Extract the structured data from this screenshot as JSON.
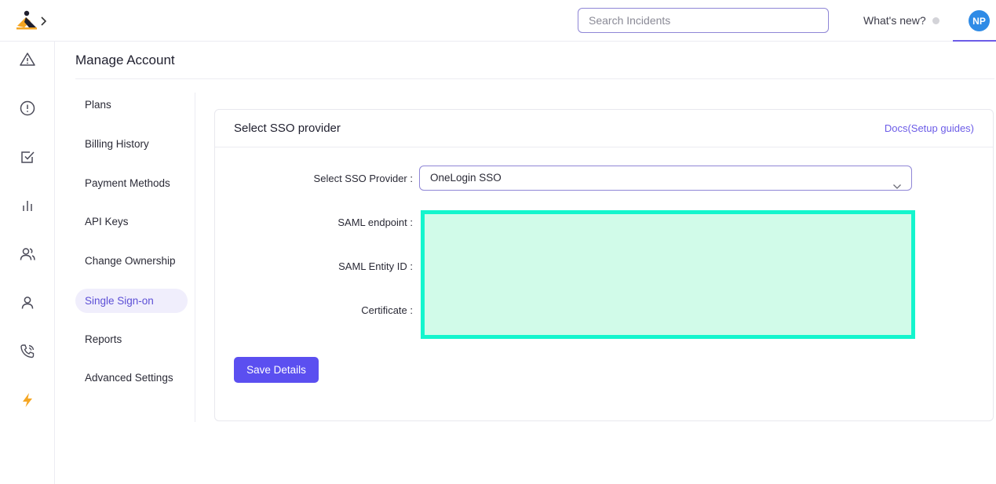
{
  "header": {
    "search_placeholder": "Search Incidents",
    "whats_new": "What's new?",
    "avatar_initials": "NP"
  },
  "rail": {
    "icons": [
      "alert-triangle-icon",
      "alert-circle-icon",
      "checkbox-icon",
      "bar-chart-icon",
      "users-icon",
      "user-icon",
      "phone-call-icon",
      "lightning-icon"
    ]
  },
  "page": {
    "title": "Manage Account"
  },
  "subnav": {
    "items": [
      {
        "label": "Plans"
      },
      {
        "label": "Billing History"
      },
      {
        "label": "Payment Methods"
      },
      {
        "label": "API Keys"
      },
      {
        "label": "Change Ownership"
      },
      {
        "label": "Single Sign-on"
      },
      {
        "label": "Reports"
      },
      {
        "label": "Advanced Settings"
      }
    ],
    "active": "Single Sign-on"
  },
  "card": {
    "title": "Select SSO provider",
    "docs_link": "Docs(Setup guides)",
    "provider_label": "Select SSO Provider :",
    "provider_value": "OneLogin SSO",
    "saml_endpoint_label": "SAML endpoint :",
    "saml_entity_label": "SAML Entity ID :",
    "certificate_label": "Certificate :",
    "save_label": "Save Details"
  },
  "colors": {
    "accent": "#6c5ce7",
    "button": "#5b4ff0",
    "avatar": "#2f8be6",
    "redaction_fill": "#d1fbe9",
    "redaction_border": "#14f5cd",
    "lightning": "#f5a623"
  }
}
